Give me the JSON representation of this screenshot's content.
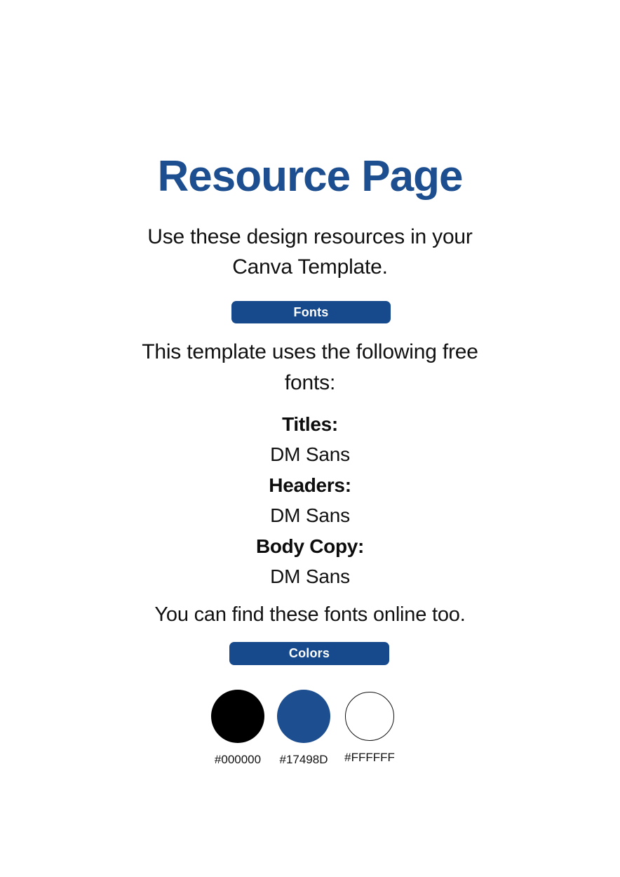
{
  "page": {
    "title": "Resource Page",
    "subtitle": "Use these design resources in your Canva Template.",
    "background_color": "#FFFFFF"
  },
  "sections": {
    "fonts": {
      "badge_label": "Fonts",
      "badge_color": "#17498D",
      "intro": "This template uses the following free fonts:",
      "items": [
        {
          "label": "Titles:",
          "value": "DM Sans"
        },
        {
          "label": "Headers:",
          "value": "DM Sans"
        },
        {
          "label": "Body Copy:",
          "value": "DM Sans"
        }
      ],
      "outro": "You can find these fonts online too."
    },
    "colors": {
      "badge_label": "Colors",
      "badge_color": "#17498D",
      "swatches": [
        {
          "hex": "#000000",
          "fill": "#000000",
          "stroke": "none"
        },
        {
          "hex": "#17498D",
          "fill": "#1D4E8F",
          "stroke": "none"
        },
        {
          "hex": "#FFFFFF",
          "fill": "#FFFFFF",
          "stroke": "#111111"
        }
      ]
    }
  }
}
